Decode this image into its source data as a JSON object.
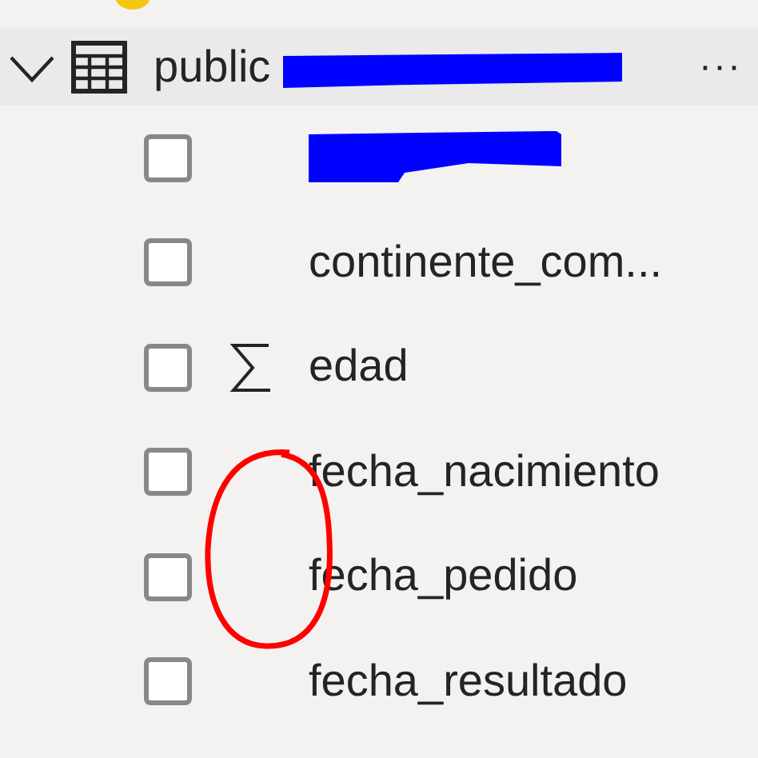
{
  "table": {
    "name": "public",
    "expanded": true,
    "name_redacted": true,
    "more": "···"
  },
  "fields": [
    {
      "kind": "redacted",
      "checked": false
    },
    {
      "kind": "text",
      "label": "continente_com...",
      "checked": false
    },
    {
      "kind": "measure",
      "label": "edad",
      "checked": false
    },
    {
      "kind": "text",
      "label": "fecha_nacimiento",
      "checked": false
    },
    {
      "kind": "text",
      "label": "fecha_pedido",
      "checked": false
    },
    {
      "kind": "text",
      "label": "fecha_resultado",
      "checked": false
    }
  ],
  "annotation": {
    "kind": "circle"
  }
}
